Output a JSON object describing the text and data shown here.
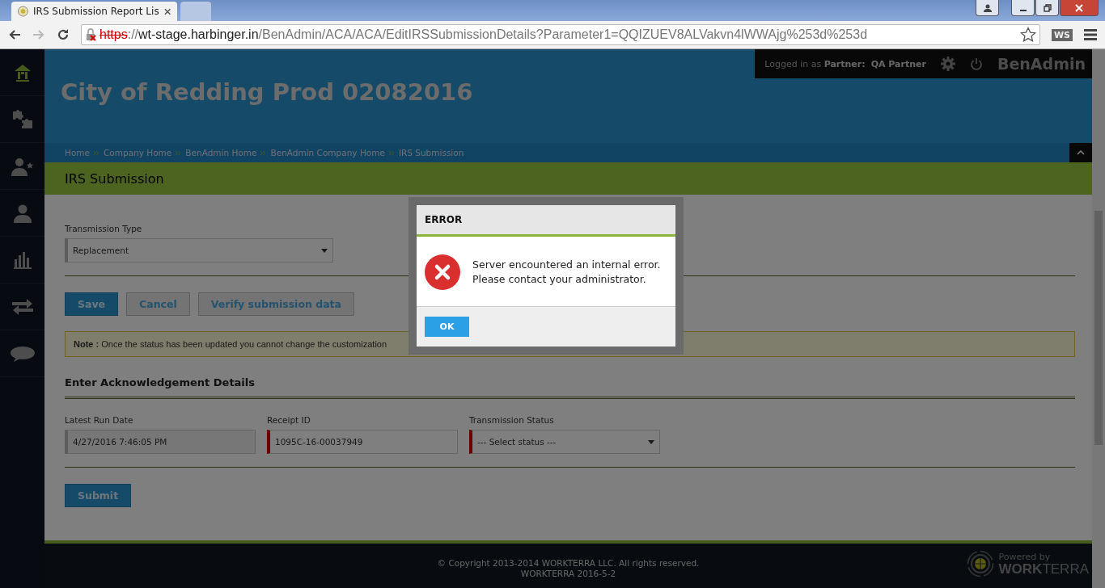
{
  "browser": {
    "tabs": [
      {
        "title": "IRS Submission Report Lis",
        "selected": true
      },
      {
        "selected": false
      }
    ],
    "url": {
      "scheme": "https",
      "rest": "://",
      "host": "wt-stage.harbinger.in",
      "path": "/BenAdmin/ACA/ACA/EditIRSSubmissionDetails?Parameter1=QQIZUEV8ALVakvn4lWWAjg%253d%253d",
      "insecure": true
    },
    "extension": "WS"
  },
  "sidebar": {
    "items": [
      {
        "kind": "home",
        "selected": true
      },
      {
        "kind": "puzzle",
        "selected": false
      },
      {
        "kind": "user-star",
        "selected": false
      },
      {
        "kind": "user",
        "selected": false
      },
      {
        "kind": "chart",
        "selected": false
      },
      {
        "kind": "transfer",
        "selected": false
      },
      {
        "kind": "chat",
        "selected": false
      }
    ]
  },
  "header": {
    "logged_in": "Logged in as",
    "role": "Partner:",
    "user": "QA Partner",
    "app": "BenAdmin",
    "company": "City of Redding Prod 02082016",
    "breadcrumbs": [
      "Home",
      "Company Home",
      "BenAdmin Home",
      "BenAdmin Company Home",
      "IRS Submission"
    ]
  },
  "page_title": "IRS Submission",
  "transmission_type": {
    "label": "Transmission Type",
    "value": "Replacement"
  },
  "buttons": [
    {
      "label": "Save",
      "kind": "primary"
    },
    {
      "label": "Cancel",
      "kind": "secondary"
    },
    {
      "label": "Verify submission data",
      "kind": "secondary"
    }
  ],
  "note": {
    "label": "Note :",
    "text": "Once the status has been updated you cannot change the customization"
  },
  "section_title": "Enter Acknowledgement Details",
  "fields": [
    {
      "label": "Latest Run Date",
      "value": "4/27/2016 7:46:05 PM",
      "kind": "readonly"
    },
    {
      "label": "Receipt ID",
      "value": "1095C-16-00037949",
      "kind": "required"
    },
    {
      "label": "Transmission Status",
      "value": "--- Select status ---",
      "kind": "select"
    }
  ],
  "submit": "Submit",
  "dialog": {
    "title": "ERROR",
    "lines": [
      "Server encountered an internal error.",
      "Please contact your administrator."
    ],
    "ok": "OK"
  },
  "footer": {
    "copyright": "© Copyright 2013-2014 WORKTERRA LLC. All rights reserved.",
    "version": "WORKTERRA 2016-5-2",
    "powered": "Powered by",
    "brand": "**WORK**TERRA"
  }
}
